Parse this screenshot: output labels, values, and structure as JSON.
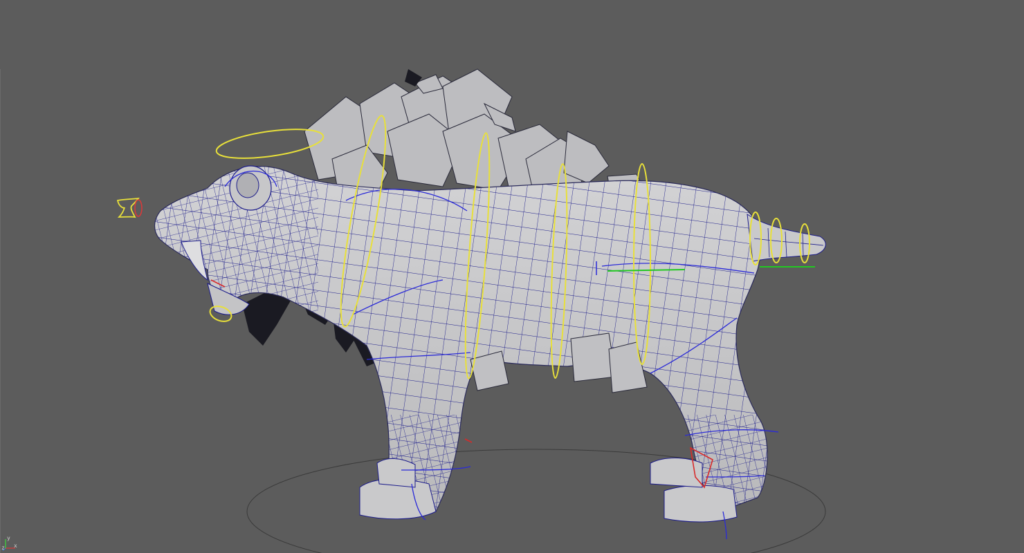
{
  "app": {
    "view": "3D viewport",
    "background_color": "#5c5c5c"
  },
  "model": {
    "icon": "saber-tooth-tiger-mesh-icon",
    "mesh_color": "#c9c9cb",
    "wireframe_color": "#1b1b8a",
    "spike_plates_color": "#bdbdc0"
  },
  "rig_controls": {
    "head_ring_color": "#e8e03a",
    "body_ring_color": "#e8e03a",
    "spine_curve_color": "#2a2ad8",
    "hip_pivot_color": "#22c822",
    "tail_ring_color": "#e8e03a",
    "foot_ik_color": "#d82a2a",
    "ground_circle_color": "#3a3a3a"
  },
  "axis_gizmo": {
    "icon": "axis-gizmo-icon",
    "x_label": "x",
    "y_label": "y",
    "z_label": "z",
    "x_color": "#d83a3a",
    "y_color": "#3ad83a",
    "z_color": "#3a7ad8"
  }
}
